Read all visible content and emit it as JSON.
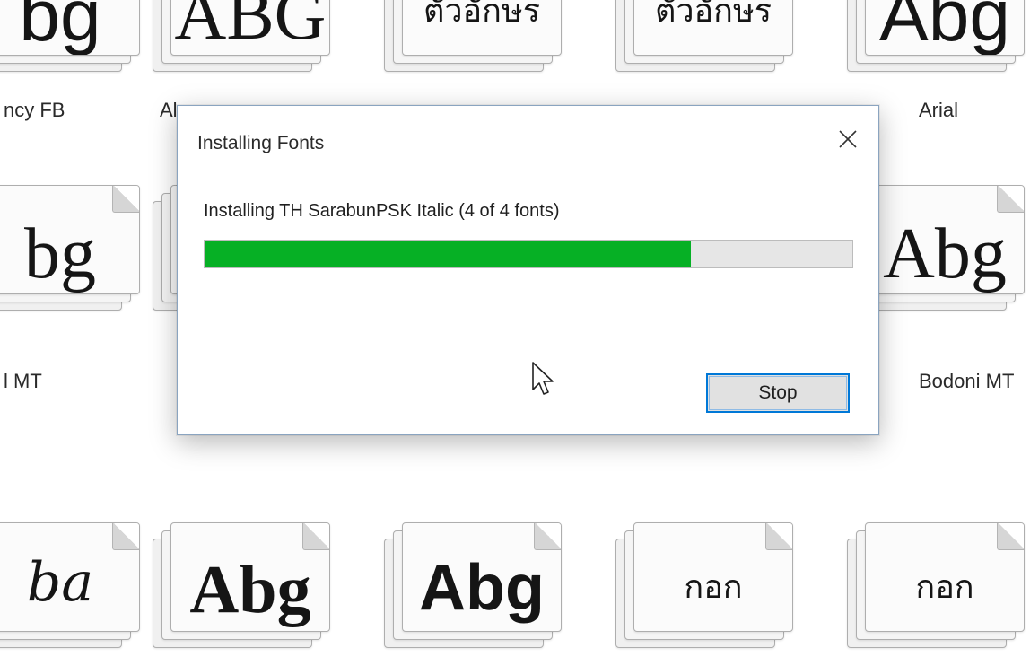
{
  "explorer": {
    "rows": [
      [
        {
          "label": "ncy FB",
          "sample": "bg",
          "sample_style": "sans"
        },
        {
          "label": "Al",
          "sample": "ABG",
          "sample_style": "serif"
        },
        {
          "label": "",
          "sample": "ตัวอักษร",
          "sample_style": "thai"
        },
        {
          "label": "",
          "sample": "ตัวอักษร",
          "sample_style": "thai"
        },
        {
          "label": "Arial",
          "sample": "Abg",
          "sample_style": "sans"
        }
      ],
      [
        {
          "label": "l MT",
          "sample": "bg",
          "sample_style": "serif"
        },
        {
          "label": "",
          "sample": "",
          "sample_style": "serif"
        },
        {
          "label": "",
          "sample": "",
          "sample_style": "serif"
        },
        {
          "label": "",
          "sample": "",
          "sample_style": "serif"
        },
        {
          "label": "Bodoni MT",
          "sample": "Abg",
          "sample_style": "serif"
        }
      ],
      [
        {
          "label": "",
          "sample": "ba",
          "sample_style": "script"
        },
        {
          "label": "",
          "sample": "Abg",
          "sample_style": "serif-bold"
        },
        {
          "label": "",
          "sample": "Abg",
          "sample_style": "sans-bold"
        },
        {
          "label": "",
          "sample": "กอก",
          "sample_style": "thai"
        },
        {
          "label": "",
          "sample": "กอก",
          "sample_style": "thai"
        }
      ]
    ]
  },
  "dialog": {
    "title": "Installing Fonts",
    "status_text": "Installing TH SarabunPSK Italic (4 of 4 fonts)",
    "progress": 0.75,
    "stop_label": "Stop",
    "progress_color": "#06b025",
    "accent_color": "#0078d7"
  },
  "icons": {
    "close": "close-icon",
    "cursor": "mouse-pointer-icon"
  }
}
